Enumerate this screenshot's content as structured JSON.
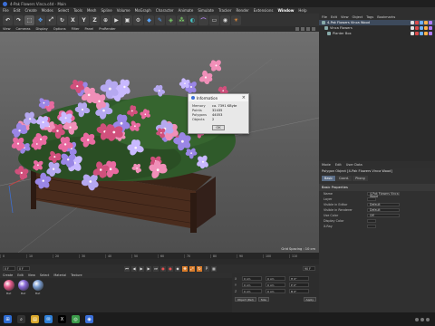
{
  "app": {
    "title": "4-Pak Flowers Vinca.c4d - Main",
    "menu": [
      "File",
      "Edit",
      "Create",
      "Modes",
      "Select",
      "Tools",
      "Mesh",
      "Spline",
      "Volume",
      "MoGraph",
      "Character",
      "Animate",
      "Simulate",
      "Tracker",
      "Render",
      "Extensions",
      "Window",
      "Help"
    ],
    "menu_highlight": "Window"
  },
  "toolbar": {
    "buttons": [
      {
        "name": "undo",
        "glyph": "↶",
        "tone": ""
      },
      {
        "name": "redo",
        "glyph": "↷",
        "tone": ""
      },
      {
        "name": "live-select",
        "glyph": "⬚",
        "tone": "sel"
      },
      {
        "name": "move",
        "glyph": "✥",
        "tone": "blue"
      },
      {
        "name": "scale",
        "glyph": "⤢",
        "tone": ""
      },
      {
        "name": "rotate",
        "glyph": "↻",
        "tone": ""
      },
      {
        "name": "axis-x",
        "glyph": "X",
        "tone": ""
      },
      {
        "name": "axis-y",
        "glyph": "Y",
        "tone": ""
      },
      {
        "name": "axis-z",
        "glyph": "Z",
        "tone": ""
      },
      {
        "name": "coord-system",
        "glyph": "⊕",
        "tone": ""
      },
      {
        "name": "render-view",
        "glyph": "▶",
        "tone": ""
      },
      {
        "name": "render-picture",
        "glyph": "▣",
        "tone": ""
      },
      {
        "name": "render-settings",
        "glyph": "⚙",
        "tone": ""
      },
      {
        "name": "cube",
        "glyph": "◆",
        "tone": "blue"
      },
      {
        "name": "pen",
        "glyph": "✎",
        "tone": "blue"
      },
      {
        "name": "subdivision",
        "glyph": "◈",
        "tone": "green"
      },
      {
        "name": "array",
        "glyph": "⁂",
        "tone": "green"
      },
      {
        "name": "boole",
        "glyph": "◐",
        "tone": "teal"
      },
      {
        "name": "bend",
        "glyph": "⌒",
        "tone": "purple"
      },
      {
        "name": "floor",
        "glyph": "▭",
        "tone": ""
      },
      {
        "name": "camera",
        "glyph": "◉",
        "tone": ""
      },
      {
        "name": "light",
        "glyph": "☀",
        "tone": "orange"
      }
    ]
  },
  "viewport_menu": [
    "View",
    "Cameras",
    "Display",
    "Options",
    "Filter",
    "Panel",
    "ProRender"
  ],
  "viewport": {
    "grid_info": "Grid Spacing : 10 cm"
  },
  "dialog": {
    "title": "Information",
    "rows": [
      {
        "k": "Memory",
        "v": "ca. 7391 KByte"
      },
      {
        "k": "Points",
        "v": "32435"
      },
      {
        "k": "Polygons",
        "v": "44053"
      },
      {
        "k": "Objects",
        "v": "2"
      }
    ],
    "ok": "OK"
  },
  "object_manager": {
    "tabs": [
      "File",
      "Edit",
      "View",
      "Object",
      "Tags",
      "Bookmarks"
    ],
    "rows": [
      {
        "label": "4-Pak Flowers Vinca Wood",
        "selected": true
      },
      {
        "label": "Vinca Flowers",
        "selected": false
      },
      {
        "label": "Planter Box",
        "selected": false
      }
    ]
  },
  "attributes": {
    "tabs_menu": [
      "Mode",
      "Edit",
      "User Data"
    ],
    "object_title": "Polygon Object [4-Pak Flowers Vinca Wood]",
    "tabs": [
      "Basic",
      "Coord.",
      "Phong"
    ],
    "active_tab": "Basic",
    "section": "Basic Properties",
    "rows": [
      {
        "label": "Name",
        "value": "4-Pak Flowers Vinca Wood"
      },
      {
        "label": "Layer",
        "value": ""
      },
      {
        "label": "Visible in Editor",
        "value": "Default"
      },
      {
        "label": "Visible in Renderer",
        "value": "Default"
      },
      {
        "label": "Use Color",
        "value": "Off"
      },
      {
        "label": "Display Color",
        "value": ""
      },
      {
        "label": "X-Ray",
        "value": ""
      }
    ]
  },
  "timeline": {
    "ticks": [
      "0",
      "10",
      "20",
      "30",
      "40",
      "50",
      "60",
      "70",
      "80",
      "90",
      "100",
      "110"
    ],
    "start": "0 F",
    "current": "0 F",
    "end": "90 F"
  },
  "materials": {
    "menu": [
      "Create",
      "Edit",
      "View",
      "Select",
      "Material",
      "Texture"
    ],
    "items": [
      {
        "label": "Mat",
        "color": "#e35a8a"
      },
      {
        "label": "Mat",
        "color": "#8a6ad8"
      },
      {
        "label": "Mat",
        "color": "#7b9ed1"
      }
    ]
  },
  "coordinates": {
    "rows": [
      {
        "axis": "X",
        "pos": "0 cm",
        "size": "0 cm",
        "rot": "H 0°"
      },
      {
        "axis": "Y",
        "pos": "0 cm",
        "size": "0 cm",
        "rot": "P 0°"
      },
      {
        "axis": "Z",
        "pos": "0 cm",
        "size": "0 cm",
        "rot": "B 0°"
      }
    ],
    "object_mode": "Object (Rel)",
    "size_mode": "Size",
    "apply": "Apply"
  },
  "taskbar": {
    "apps": [
      {
        "name": "start",
        "glyph": "⊞",
        "color": "#2d6bd1"
      },
      {
        "name": "search",
        "glyph": "⌕",
        "color": "#333"
      },
      {
        "name": "explorer",
        "glyph": "▤",
        "color": "#d9a72b"
      },
      {
        "name": "mail",
        "glyph": "✉",
        "color": "#2f7fd6"
      },
      {
        "name": "x",
        "glyph": "X",
        "color": "#000"
      },
      {
        "name": "chrome",
        "glyph": "◎",
        "color": "#3b9b4a"
      },
      {
        "name": "cinema4d",
        "glyph": "◉",
        "color": "#3b6fd8"
      }
    ]
  }
}
